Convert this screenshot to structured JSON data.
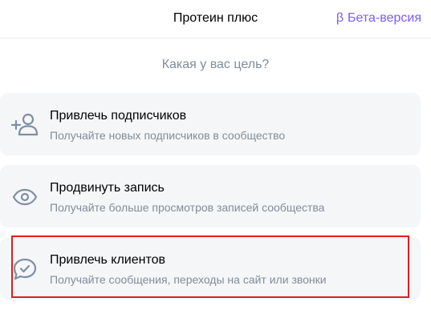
{
  "header": {
    "title": "Протеин плюс",
    "beta_symbol": "β",
    "beta_label": "Бета-версия"
  },
  "question": "Какая у вас цель?",
  "goals": [
    {
      "title": "Привлечь подписчиков",
      "description": "Получайте новых подписчиков в сообщество",
      "icon": "add-user-icon"
    },
    {
      "title": "Продвинуть запись",
      "description": "Получайте больше просмотров записей сообщества",
      "icon": "eye-icon"
    },
    {
      "title": "Привлечь клиентов",
      "description": "Получайте сообщения, переходы на сайт или звонки",
      "icon": "chat-check-icon"
    }
  ],
  "colors": {
    "accent": "#7a5cff",
    "icon": "#7f8fa3",
    "card_bg": "#f5f6f8",
    "highlight": "#e81b1b"
  }
}
